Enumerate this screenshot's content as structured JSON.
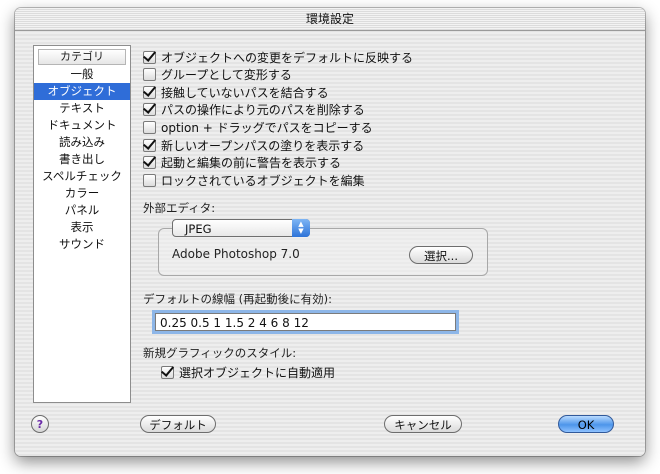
{
  "window": {
    "title": "環境設定"
  },
  "sidebar": {
    "header": "カテゴリ",
    "items": [
      {
        "label": "一般",
        "selected": false
      },
      {
        "label": "オブジェクト",
        "selected": true
      },
      {
        "label": "テキスト",
        "selected": false
      },
      {
        "label": "ドキュメント",
        "selected": false
      },
      {
        "label": "読み込み",
        "selected": false
      },
      {
        "label": "書き出し",
        "selected": false
      },
      {
        "label": "スペルチェック",
        "selected": false
      },
      {
        "label": "カラー",
        "selected": false
      },
      {
        "label": "パネル",
        "selected": false
      },
      {
        "label": "表示",
        "selected": false
      },
      {
        "label": "サウンド",
        "selected": false
      }
    ]
  },
  "options": [
    {
      "label": "オブジェクトへの変更をデフォルトに反映する",
      "checked": true
    },
    {
      "label": "グループとして変形する",
      "checked": false
    },
    {
      "label": "接触していないパスを結合する",
      "checked": true
    },
    {
      "label": "パスの操作により元のパスを削除する",
      "checked": true
    },
    {
      "label": "option + ドラッグでパスをコピーする",
      "checked": false
    },
    {
      "label": "新しいオープンパスの塗りを表示する",
      "checked": true
    },
    {
      "label": "起動と編集の前に警告を表示する",
      "checked": true
    },
    {
      "label": "ロックされているオブジェクトを編集",
      "checked": false
    }
  ],
  "external_editor": {
    "label": "外部エディタ:",
    "format_selected": "JPEG",
    "app_name": "Adobe Photoshop 7.0",
    "choose_button": "選択..."
  },
  "line_width": {
    "label": "デフォルトの線幅 (再起動後に有効):",
    "value": "0.25 0.5 1 1.5 2 4 6 8 12"
  },
  "new_graphic_style": {
    "label": "新規グラフィックのスタイル:",
    "auto_apply_label": "選択オブジェクトに自動適用",
    "auto_apply_checked": true
  },
  "footer": {
    "help": "?",
    "default_button": "デフォルト",
    "cancel_button": "キャンセル",
    "ok_button": "OK"
  }
}
